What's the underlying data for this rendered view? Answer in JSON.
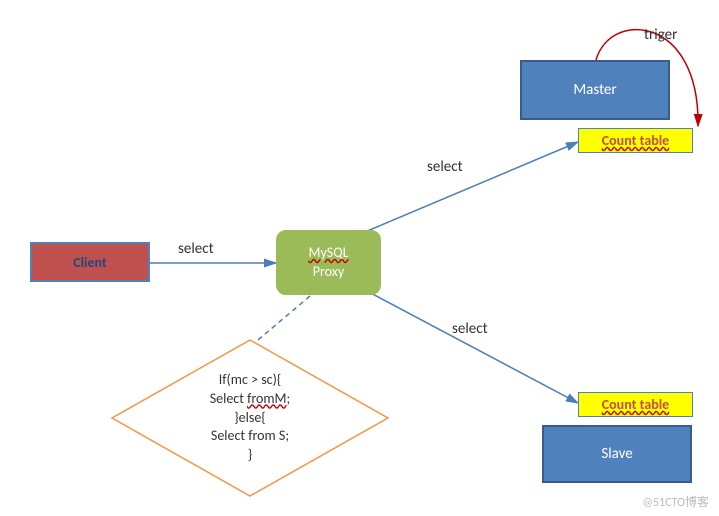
{
  "nodes": {
    "client": "Client",
    "proxy_line1": "MySQL",
    "proxy_line2": "Proxy",
    "master": "Master",
    "slave": "Slave",
    "count_table_1": "Count  table",
    "count_table_2": "Count  table"
  },
  "edges": {
    "client_to_proxy": "select",
    "proxy_to_master": "select",
    "proxy_to_slave": "select",
    "master_trigger": "triger"
  },
  "decision": {
    "line1": "If(mc > sc){",
    "line2_pre": "Select ",
    "line2_mid": "fromM",
    "line2_post": ";",
    "line3": "}else{",
    "line4": "Select from S;",
    "line5": "}"
  },
  "watermark": "@51CTO博客"
}
